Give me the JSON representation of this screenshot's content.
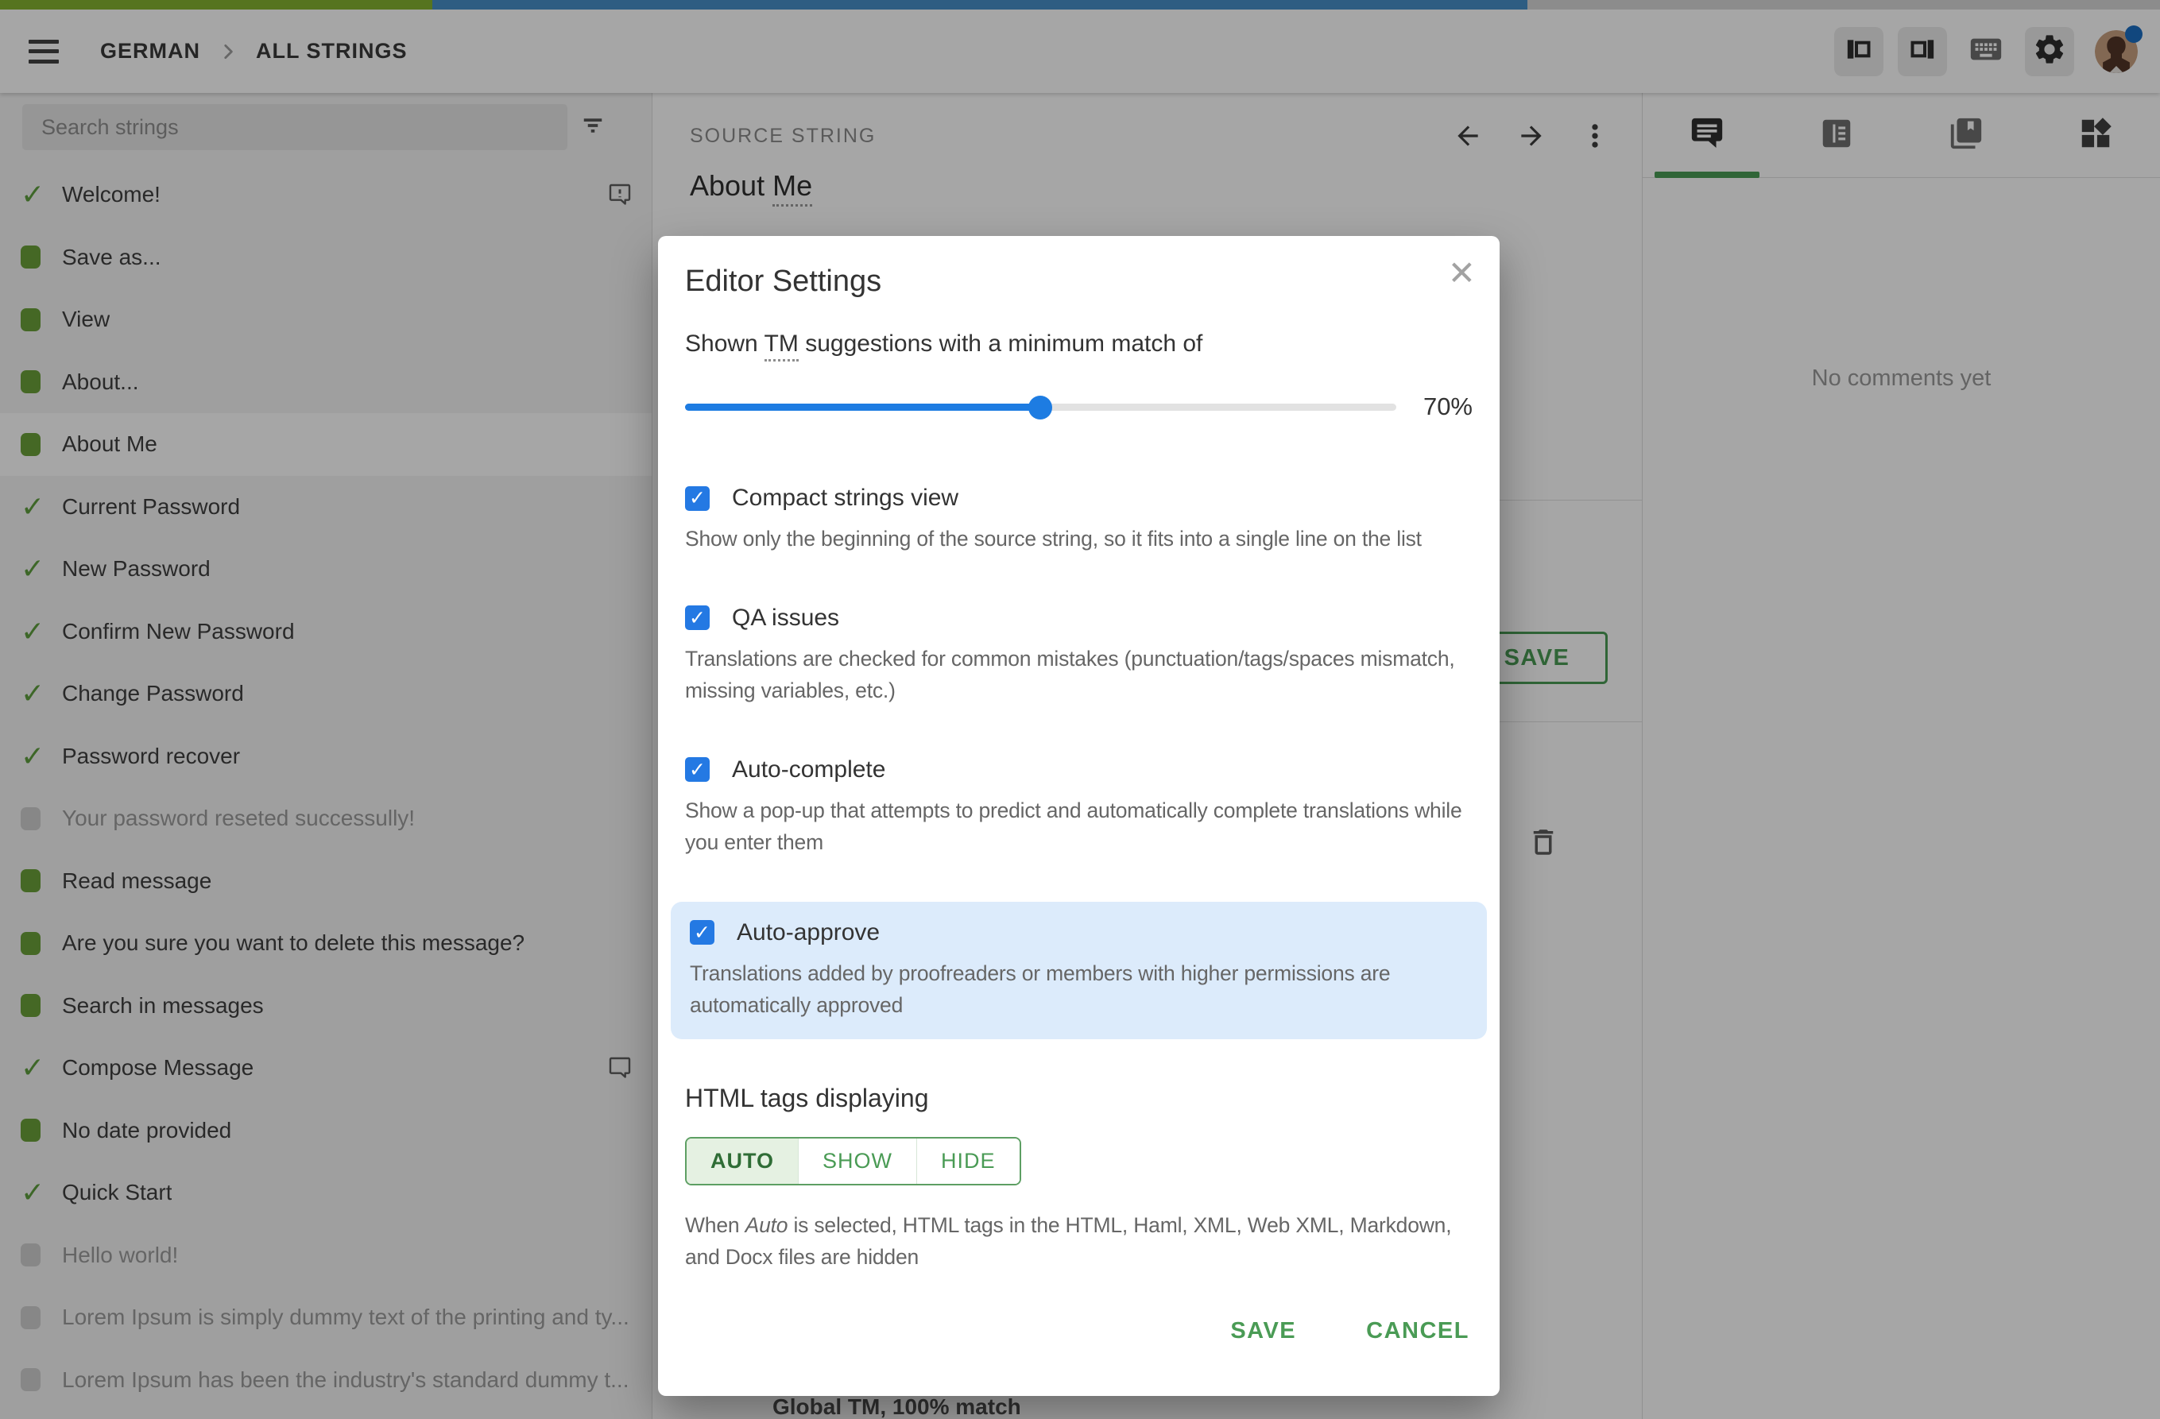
{
  "topbar": {
    "breadcrumb": {
      "project": "GERMAN",
      "section": "ALL STRINGS"
    },
    "progress": {
      "segments": [
        {
          "name": "approved",
          "color": "#84b330",
          "percent": 20.0
        },
        {
          "name": "translated",
          "color": "#4790c8",
          "percent": 50.7
        },
        {
          "name": "remaining",
          "color": "#d8d8d8",
          "percent": 29.3
        }
      ]
    },
    "actions": [
      "panel-left",
      "panel-right",
      "keyboard",
      "settings-gear",
      "avatar"
    ]
  },
  "sidebar": {
    "search": {
      "placeholder": "Search strings"
    },
    "strings": [
      {
        "label": "Welcome!",
        "status": "approved",
        "comment": "unresolved"
      },
      {
        "label": "Save as...",
        "status": "translated"
      },
      {
        "label": "View",
        "status": "translated"
      },
      {
        "label": "About...",
        "status": "translated"
      },
      {
        "label": "About Me",
        "status": "translated",
        "selected": true
      },
      {
        "label": "Current Password",
        "status": "approved"
      },
      {
        "label": "New Password",
        "status": "approved"
      },
      {
        "label": "Confirm New Password",
        "status": "approved"
      },
      {
        "label": "Change Password",
        "status": "approved"
      },
      {
        "label": "Password recover",
        "status": "approved"
      },
      {
        "label": "Your password reseted successully!",
        "status": "untranslated"
      },
      {
        "label": "Read message",
        "status": "translated"
      },
      {
        "label": "Are you sure you want to delete this message?",
        "status": "translated"
      },
      {
        "label": "Search in messages",
        "status": "translated"
      },
      {
        "label": "Compose Message",
        "status": "approved",
        "comment": "plain"
      },
      {
        "label": "No date provided",
        "status": "translated"
      },
      {
        "label": "Quick Start",
        "status": "approved"
      },
      {
        "label": "Hello world!",
        "status": "untranslated"
      },
      {
        "label": "Lorem Ipsum is simply dummy text of the printing and ty...",
        "status": "untranslated"
      },
      {
        "label": "Lorem Ipsum has been the industry's standard dummy t...",
        "status": "untranslated"
      }
    ]
  },
  "source_panel": {
    "header": "SOURCE STRING",
    "source_text_prefix": "About ",
    "source_text_term": "Me",
    "save_button": "SAVE",
    "tm_match": "Global TM, 100% match"
  },
  "right_panel": {
    "tabs": [
      "comments",
      "context",
      "glossary",
      "others"
    ],
    "active_tab": "comments",
    "empty_message": "No comments yet"
  },
  "modal": {
    "title": "Editor Settings",
    "tm_setting": {
      "text_before": "Shown ",
      "term": "TM",
      "text_after": " suggestions with a minimum match of",
      "value": "70%",
      "slider_percent": 50
    },
    "checkboxes": [
      {
        "label": "Compact strings view",
        "description": "Show only the beginning of the source string, so it fits into a single line on the list",
        "checked": true,
        "highlighted": false
      },
      {
        "label": "QA issues",
        "description": "Translations are checked for common mistakes (punctuation/tags/spaces mismatch, missing variables, etc.)",
        "checked": true,
        "highlighted": false
      },
      {
        "label": "Auto-complete",
        "description": "Show a pop-up that attempts to predict and automatically complete translations while you enter them",
        "checked": true,
        "highlighted": false
      },
      {
        "label": "Auto-approve",
        "description": "Translations added by proofreaders or members with higher permissions are automatically approved",
        "checked": true,
        "highlighted": true
      }
    ],
    "html_tags": {
      "heading": "HTML tags displaying",
      "options": [
        "AUTO",
        "SHOW",
        "HIDE"
      ],
      "selected": "AUTO",
      "note_before": "When ",
      "note_italic": "Auto",
      "note_after": " is selected, HTML tags in the HTML, Haml, XML, Web XML, Markdown, and Docx files are hidden"
    },
    "buttons": {
      "save": "SAVE",
      "cancel": "CANCEL"
    }
  },
  "colors": {
    "accent_green": "#4a9b55",
    "checkbox_blue": "#2479e3",
    "slider_blue": "#1d7ce2",
    "highlight_blue_bg": "#dcebfb",
    "status_green": "#6ba03a",
    "status_gray": "#cfcfcf",
    "avatar_badge_blue": "#1b6ec2"
  }
}
